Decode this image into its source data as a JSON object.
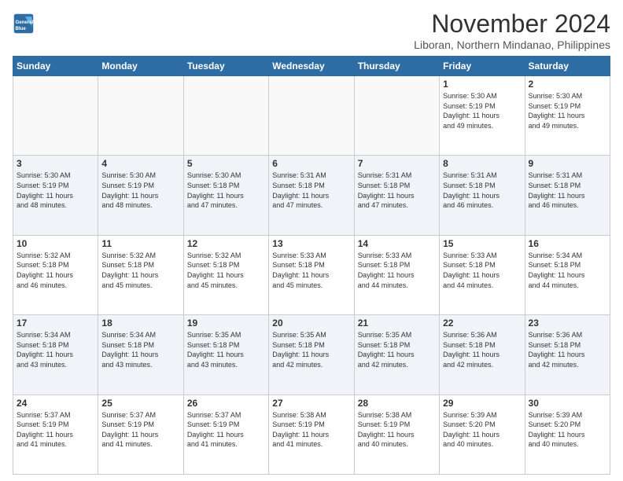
{
  "header": {
    "logo_line1": "General",
    "logo_line2": "Blue",
    "month": "November 2024",
    "location": "Liboran, Northern Mindanao, Philippines"
  },
  "weekdays": [
    "Sunday",
    "Monday",
    "Tuesday",
    "Wednesday",
    "Thursday",
    "Friday",
    "Saturday"
  ],
  "weeks": [
    [
      {
        "day": "",
        "info": ""
      },
      {
        "day": "",
        "info": ""
      },
      {
        "day": "",
        "info": ""
      },
      {
        "day": "",
        "info": ""
      },
      {
        "day": "",
        "info": ""
      },
      {
        "day": "1",
        "info": "Sunrise: 5:30 AM\nSunset: 5:19 PM\nDaylight: 11 hours\nand 49 minutes."
      },
      {
        "day": "2",
        "info": "Sunrise: 5:30 AM\nSunset: 5:19 PM\nDaylight: 11 hours\nand 49 minutes."
      }
    ],
    [
      {
        "day": "3",
        "info": "Sunrise: 5:30 AM\nSunset: 5:19 PM\nDaylight: 11 hours\nand 48 minutes."
      },
      {
        "day": "4",
        "info": "Sunrise: 5:30 AM\nSunset: 5:19 PM\nDaylight: 11 hours\nand 48 minutes."
      },
      {
        "day": "5",
        "info": "Sunrise: 5:30 AM\nSunset: 5:18 PM\nDaylight: 11 hours\nand 47 minutes."
      },
      {
        "day": "6",
        "info": "Sunrise: 5:31 AM\nSunset: 5:18 PM\nDaylight: 11 hours\nand 47 minutes."
      },
      {
        "day": "7",
        "info": "Sunrise: 5:31 AM\nSunset: 5:18 PM\nDaylight: 11 hours\nand 47 minutes."
      },
      {
        "day": "8",
        "info": "Sunrise: 5:31 AM\nSunset: 5:18 PM\nDaylight: 11 hours\nand 46 minutes."
      },
      {
        "day": "9",
        "info": "Sunrise: 5:31 AM\nSunset: 5:18 PM\nDaylight: 11 hours\nand 46 minutes."
      }
    ],
    [
      {
        "day": "10",
        "info": "Sunrise: 5:32 AM\nSunset: 5:18 PM\nDaylight: 11 hours\nand 46 minutes."
      },
      {
        "day": "11",
        "info": "Sunrise: 5:32 AM\nSunset: 5:18 PM\nDaylight: 11 hours\nand 45 minutes."
      },
      {
        "day": "12",
        "info": "Sunrise: 5:32 AM\nSunset: 5:18 PM\nDaylight: 11 hours\nand 45 minutes."
      },
      {
        "day": "13",
        "info": "Sunrise: 5:33 AM\nSunset: 5:18 PM\nDaylight: 11 hours\nand 45 minutes."
      },
      {
        "day": "14",
        "info": "Sunrise: 5:33 AM\nSunset: 5:18 PM\nDaylight: 11 hours\nand 44 minutes."
      },
      {
        "day": "15",
        "info": "Sunrise: 5:33 AM\nSunset: 5:18 PM\nDaylight: 11 hours\nand 44 minutes."
      },
      {
        "day": "16",
        "info": "Sunrise: 5:34 AM\nSunset: 5:18 PM\nDaylight: 11 hours\nand 44 minutes."
      }
    ],
    [
      {
        "day": "17",
        "info": "Sunrise: 5:34 AM\nSunset: 5:18 PM\nDaylight: 11 hours\nand 43 minutes."
      },
      {
        "day": "18",
        "info": "Sunrise: 5:34 AM\nSunset: 5:18 PM\nDaylight: 11 hours\nand 43 minutes."
      },
      {
        "day": "19",
        "info": "Sunrise: 5:35 AM\nSunset: 5:18 PM\nDaylight: 11 hours\nand 43 minutes."
      },
      {
        "day": "20",
        "info": "Sunrise: 5:35 AM\nSunset: 5:18 PM\nDaylight: 11 hours\nand 42 minutes."
      },
      {
        "day": "21",
        "info": "Sunrise: 5:35 AM\nSunset: 5:18 PM\nDaylight: 11 hours\nand 42 minutes."
      },
      {
        "day": "22",
        "info": "Sunrise: 5:36 AM\nSunset: 5:18 PM\nDaylight: 11 hours\nand 42 minutes."
      },
      {
        "day": "23",
        "info": "Sunrise: 5:36 AM\nSunset: 5:18 PM\nDaylight: 11 hours\nand 42 minutes."
      }
    ],
    [
      {
        "day": "24",
        "info": "Sunrise: 5:37 AM\nSunset: 5:19 PM\nDaylight: 11 hours\nand 41 minutes."
      },
      {
        "day": "25",
        "info": "Sunrise: 5:37 AM\nSunset: 5:19 PM\nDaylight: 11 hours\nand 41 minutes."
      },
      {
        "day": "26",
        "info": "Sunrise: 5:37 AM\nSunset: 5:19 PM\nDaylight: 11 hours\nand 41 minutes."
      },
      {
        "day": "27",
        "info": "Sunrise: 5:38 AM\nSunset: 5:19 PM\nDaylight: 11 hours\nand 41 minutes."
      },
      {
        "day": "28",
        "info": "Sunrise: 5:38 AM\nSunset: 5:19 PM\nDaylight: 11 hours\nand 40 minutes."
      },
      {
        "day": "29",
        "info": "Sunrise: 5:39 AM\nSunset: 5:20 PM\nDaylight: 11 hours\nand 40 minutes."
      },
      {
        "day": "30",
        "info": "Sunrise: 5:39 AM\nSunset: 5:20 PM\nDaylight: 11 hours\nand 40 minutes."
      }
    ]
  ]
}
